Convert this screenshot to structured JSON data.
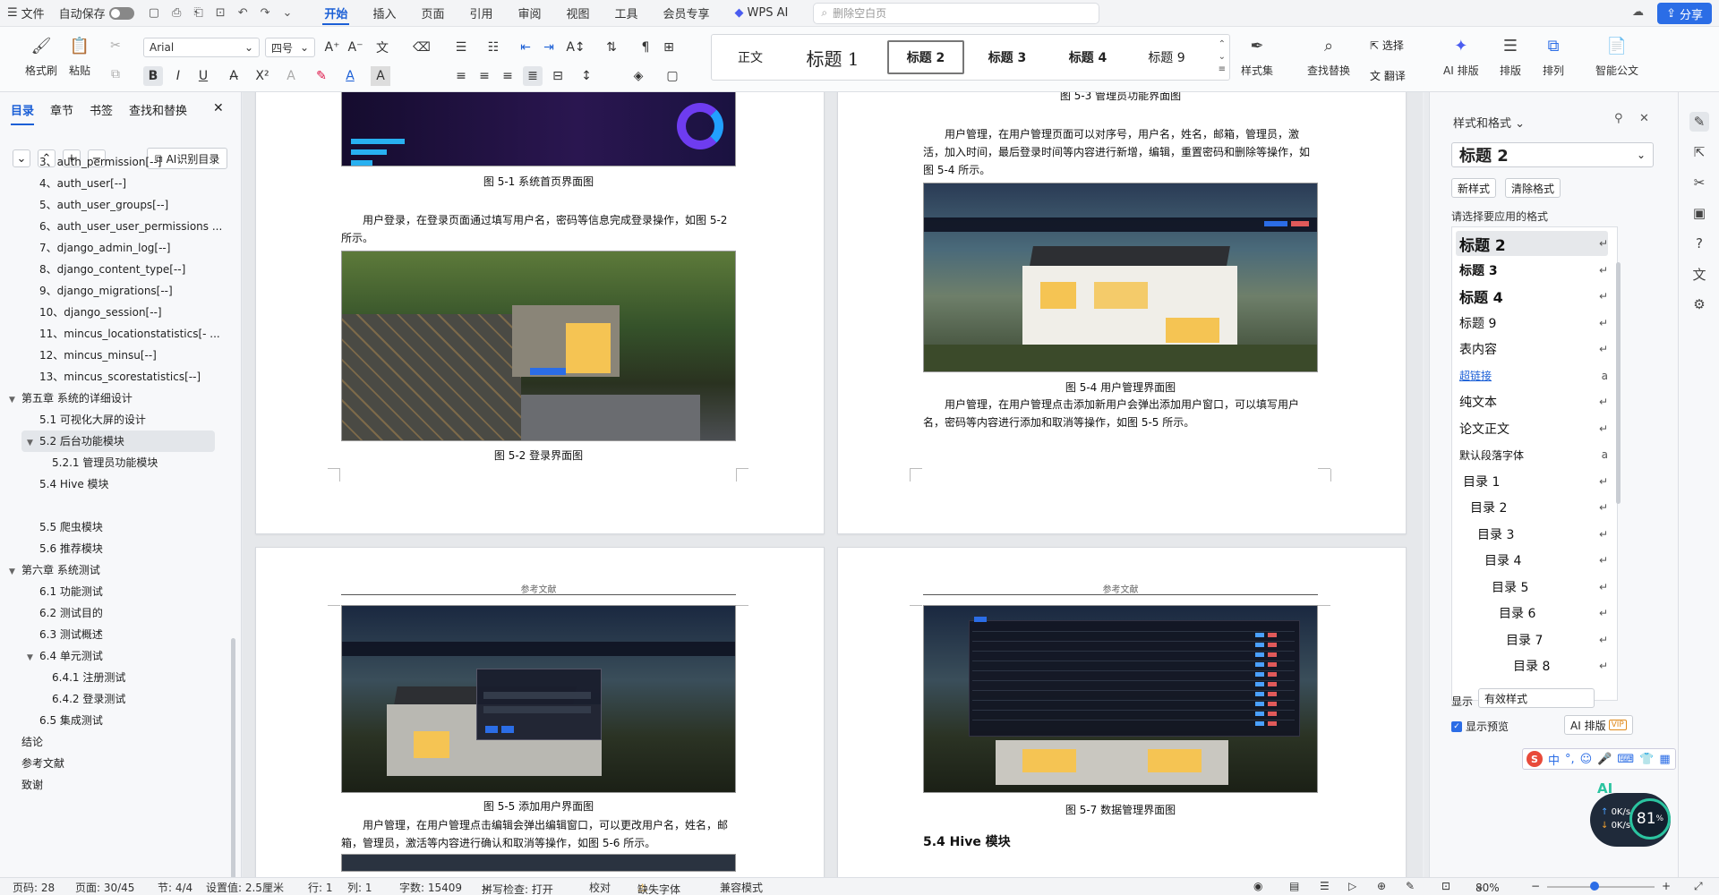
{
  "menubar": {
    "file": "文件",
    "autosave": "自动保存",
    "tabs": [
      "开始",
      "插入",
      "页面",
      "引用",
      "审阅",
      "视图",
      "工具",
      "会员专享",
      "WPS AI"
    ],
    "search_placeholder": "删除空白页",
    "share": "分享"
  },
  "ribbon": {
    "format_painter": "格式刷",
    "paste": "粘贴",
    "font_name": "Arial",
    "font_size": "四号",
    "styles": [
      "正文",
      "标题 1",
      "标题 2",
      "标题 3",
      "标题 4",
      "标题 9"
    ],
    "style_set": "样式集",
    "find_replace": "查找替换",
    "select": "选择",
    "translate": "翻译",
    "ai_layout": "AI 排版",
    "layout": "排版",
    "arrange": "排列",
    "smart_doc": "智能公文"
  },
  "nav": {
    "tabs": [
      "目录",
      "章节",
      "书签",
      "查找和替换"
    ],
    "ai_toc": "AI识别目录",
    "items": [
      {
        "text": "3、auth_permission[--]",
        "level": 3
      },
      {
        "text": "4、auth_user[--]",
        "level": 3
      },
      {
        "text": "5、auth_user_groups[--]",
        "level": 3
      },
      {
        "text": "6、auth_user_user_permissions ...",
        "level": 3
      },
      {
        "text": "7、django_admin_log[--]",
        "level": 3
      },
      {
        "text": "8、django_content_type[--]",
        "level": 3
      },
      {
        "text": "9、django_migrations[--]",
        "level": 3
      },
      {
        "text": "10、django_session[--]",
        "level": 3
      },
      {
        "text": "11、mincus_locationstatistics[- ...",
        "level": 3
      },
      {
        "text": "12、mincus_minsu[--]",
        "level": 3
      },
      {
        "text": "13、mincus_scorestatistics[--]",
        "level": 3
      },
      {
        "text": "第五章 系统的详细设计",
        "level": 1
      },
      {
        "text": "5.1 可视化大屏的设计",
        "level": 2
      },
      {
        "text": "5.2 后台功能模块",
        "level": 2
      },
      {
        "text": "5.2.1 管理员功能模块",
        "level": 3
      },
      {
        "text": "5.4 Hive 模块",
        "level": 2
      },
      {
        "text": "",
        "level": 2
      },
      {
        "text": "5.5 爬虫模块",
        "level": 2
      },
      {
        "text": "5.6 推荐模块",
        "level": 2
      },
      {
        "text": "第六章 系统测试",
        "level": 1
      },
      {
        "text": "6.1 功能测试",
        "level": 2
      },
      {
        "text": "6.2 测试目的",
        "level": 2
      },
      {
        "text": "6.3 测试概述",
        "level": 2
      },
      {
        "text": "6.4 单元测试",
        "level": 2
      },
      {
        "text": "6.4.1 注册测试",
        "level": 3
      },
      {
        "text": "6.4.2 登录测试",
        "level": 3
      },
      {
        "text": "6.5 集成测试",
        "level": 2
      },
      {
        "text": "结论",
        "level": 1
      },
      {
        "text": "参考文献",
        "level": 1
      },
      {
        "text": "致谢",
        "level": 1
      }
    ]
  },
  "doc": {
    "cap_5_1": "图 5-1 系统首页界面图",
    "para_login": "用户登录，在登录页面通过填写用户名，密码等信息完成登录操作，如图 5-2 所示。",
    "cap_5_2": "图 5-2 登录界面图",
    "cap_5_3": "图 5-3 管理员功能界面图",
    "para_user_mgmt": "用户管理，在用户管理页面可以对序号，用户名，姓名，邮箱，管理员，激活，加入时间，最后登录时间等内容进行新增，编辑，重置密码和删除等操作，如图 5-4 所示。",
    "cap_5_4": "图 5-4 用户管理界面图",
    "para_add_user": "用户管理，在用户管理点击添加新用户会弹出添加用户窗口，可以填写用户名，密码等内容进行添加和取消等操作，如图 5-5 所示。",
    "header_ref": "参考文献",
    "cap_5_5": "图 5-5 添加用户界面图",
    "para_edit_user": "用户管理，在用户管理点击编辑会弹出编辑窗口，可以更改用户名，姓名，邮箱，管理员，激活等内容进行确认和取消等操作，如图 5-6 所示。",
    "cap_5_7": "图 5-7 数据管理界面图",
    "heading_5_4": "5.4 Hive 模块"
  },
  "stylepanel": {
    "title": "样式和格式",
    "current": "标题 2",
    "new_style": "新样式",
    "clear_format": "清除格式",
    "prompt": "请选择要应用的格式",
    "items": [
      "标题 2",
      "标题 3",
      "标题 4",
      "标题 9",
      "表内容",
      "超链接",
      "纯文本",
      "论文正文",
      "默认段落字体",
      "目录 1",
      "目录 2",
      "目录 3",
      "目录 4",
      "目录 5",
      "目录 6",
      "目录 7",
      "目录 8"
    ],
    "show_label": "显示",
    "show_value": "有效样式",
    "preview": "显示预览",
    "ai_layout": "AI 排版"
  },
  "status": {
    "page_num": "页码: 28",
    "page": "页面: 30/45",
    "section": "节: 4/4",
    "setting": "设置值: 2.5厘米",
    "row": "行: 1",
    "col": "列: 1",
    "words": "字数: 15409",
    "spell": "拼写检查: 打开",
    "proof": "校对",
    "missing_font": "缺失字体",
    "compat": "兼容模式",
    "zoom": "80%"
  },
  "ime": {
    "lang": "中"
  },
  "speed": {
    "up": "0K/s",
    "down": "0K/s",
    "percent": "81"
  }
}
